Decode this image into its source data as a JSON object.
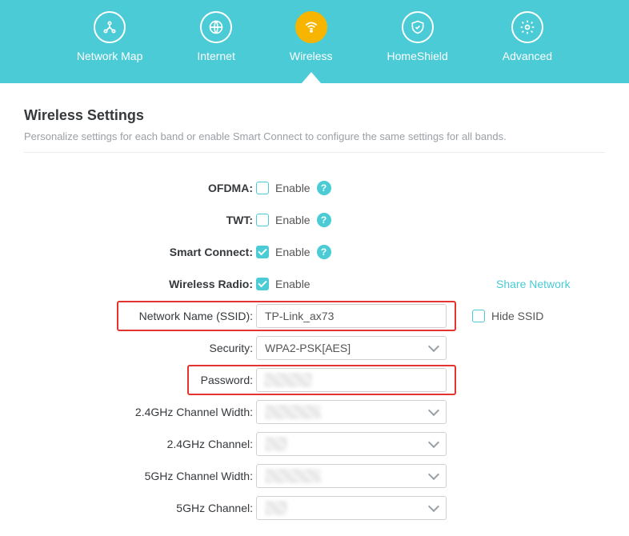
{
  "nav": {
    "items": [
      {
        "label": "Network Map",
        "icon": "network-map-icon"
      },
      {
        "label": "Internet",
        "icon": "globe-icon"
      },
      {
        "label": "Wireless",
        "icon": "wifi-icon",
        "active": true
      },
      {
        "label": "HomeShield",
        "icon": "shield-icon"
      },
      {
        "label": "Advanced",
        "icon": "gear-icon"
      }
    ]
  },
  "section": {
    "title": "Wireless Settings",
    "desc": "Personalize settings for each band or enable Smart Connect to configure the same settings for all bands."
  },
  "form": {
    "ofdma": {
      "label": "OFDMA:",
      "checkbox_label": "Enable",
      "checked": false,
      "help": true
    },
    "twt": {
      "label": "TWT:",
      "checkbox_label": "Enable",
      "checked": false,
      "help": true
    },
    "smart_connect": {
      "label": "Smart Connect:",
      "checkbox_label": "Enable",
      "checked": true,
      "help": true
    },
    "wireless_radio": {
      "label": "Wireless Radio:",
      "checkbox_label": "Enable",
      "checked": true,
      "share_link": "Share Network"
    },
    "ssid": {
      "label": "Network Name (SSID):",
      "value": "TP-Link_ax73",
      "hide_label": "Hide SSID",
      "hide_checked": false
    },
    "security": {
      "label": "Security:",
      "value": "WPA2-PSK[AES]"
    },
    "password": {
      "label": "Password:",
      "value": ""
    },
    "cw24": {
      "label": "2.4GHz Channel Width:",
      "value": ""
    },
    "ch24": {
      "label": "2.4GHz Channel:",
      "value": ""
    },
    "cw5": {
      "label": "5GHz Channel Width:",
      "value": ""
    },
    "ch5": {
      "label": "5GHz Channel:",
      "value": ""
    }
  }
}
